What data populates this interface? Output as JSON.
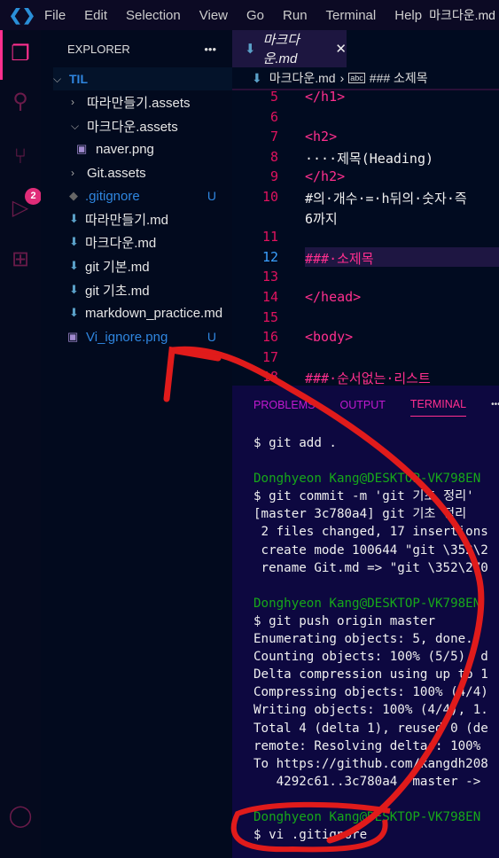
{
  "titlebar": {
    "menus": [
      "File",
      "Edit",
      "Selection",
      "View",
      "Go",
      "Run",
      "Terminal",
      "Help"
    ],
    "title": "마크다운.md"
  },
  "activity": {
    "scm_badge": "2"
  },
  "explorer": {
    "header": "EXPLORER",
    "more": "•••",
    "root": "TIL",
    "items": [
      {
        "label": "따라만들기.assets",
        "type": "folder-collapsed"
      },
      {
        "label": "마크다운.assets",
        "type": "folder-open"
      },
      {
        "label": "naver.png",
        "type": "image"
      },
      {
        "label": "Git.assets",
        "type": "folder-collapsed"
      },
      {
        "label": ".gitignore",
        "type": "git",
        "status": "U"
      },
      {
        "label": "따라만들기.md",
        "type": "md"
      },
      {
        "label": "마크다운.md",
        "type": "md"
      },
      {
        "label": "git 기본.md",
        "type": "md"
      },
      {
        "label": "git 기초.md",
        "type": "md"
      },
      {
        "label": "markdown_practice.md",
        "type": "md"
      },
      {
        "label": "Vi_ignore.png",
        "type": "image",
        "status": "U"
      }
    ]
  },
  "editor": {
    "tab": "마크다운.md",
    "breadcrumb": {
      "file": "마크다운.md",
      "symbol": "### 소제목"
    },
    "lines": [
      {
        "n": "5",
        "text": "</h1>"
      },
      {
        "n": "6",
        "text": ""
      },
      {
        "n": "7",
        "text": "<h2>"
      },
      {
        "n": "8",
        "text": "····제목(Heading)"
      },
      {
        "n": "9",
        "text": "</h2>"
      },
      {
        "n": "10",
        "text": "#의·개수·=·h뒤의·숫자·즉"
      },
      {
        "n": "",
        "text": "6까지"
      },
      {
        "n": "11",
        "text": ""
      },
      {
        "n": "12",
        "text": "###·소제목"
      },
      {
        "n": "13",
        "text": ""
      },
      {
        "n": "14",
        "text": "</head>"
      },
      {
        "n": "15",
        "text": ""
      },
      {
        "n": "16",
        "text": "<body>"
      },
      {
        "n": "17",
        "text": ""
      },
      {
        "n": "18",
        "text": "###·순서없는·리스트"
      }
    ]
  },
  "panel": {
    "tabs": [
      "PROBLEMS",
      "OUTPUT",
      "TERMINAL"
    ],
    "more": "•••",
    "terminal": [
      {
        "t": "$ git add .",
        "c": ""
      },
      {
        "t": "",
        "c": ""
      },
      {
        "t": "Donghyeon Kang@DESKTOP-VK798EN",
        "c": "g"
      },
      {
        "t": "$ git commit -m 'git 기초 정리'",
        "c": ""
      },
      {
        "t": "[master 3c780a4] git 기초 정리",
        "c": ""
      },
      {
        "t": " 2 files changed, 17 insertions",
        "c": ""
      },
      {
        "t": " create mode 100644 \"git \\352\\2",
        "c": ""
      },
      {
        "t": " rename Git.md => \"git \\352\\270",
        "c": ""
      },
      {
        "t": "",
        "c": ""
      },
      {
        "t": "Donghyeon Kang@DESKTOP-VK798EN",
        "c": "g"
      },
      {
        "t": "$ git push origin master",
        "c": ""
      },
      {
        "t": "Enumerating objects: 5, done.",
        "c": ""
      },
      {
        "t": "Counting objects: 100% (5/5), d",
        "c": ""
      },
      {
        "t": "Delta compression using up to 1",
        "c": ""
      },
      {
        "t": "Compressing objects: 100% (4/4)",
        "c": ""
      },
      {
        "t": "Writing objects: 100% (4/4), 1.",
        "c": ""
      },
      {
        "t": "Total 4 (delta 1), reused 0 (de",
        "c": ""
      },
      {
        "t": "remote: Resolving deltas: 100%",
        "c": ""
      },
      {
        "t": "To https://github.com/kangdh208",
        "c": ""
      },
      {
        "t": "   4292c61..3c780a4  master ->",
        "c": ""
      },
      {
        "t": "",
        "c": ""
      },
      {
        "t": "Donghyeon Kang@DESKTOP-VK798EN",
        "c": "g"
      },
      {
        "t": "$ vi .gitignore",
        "c": ""
      }
    ]
  }
}
